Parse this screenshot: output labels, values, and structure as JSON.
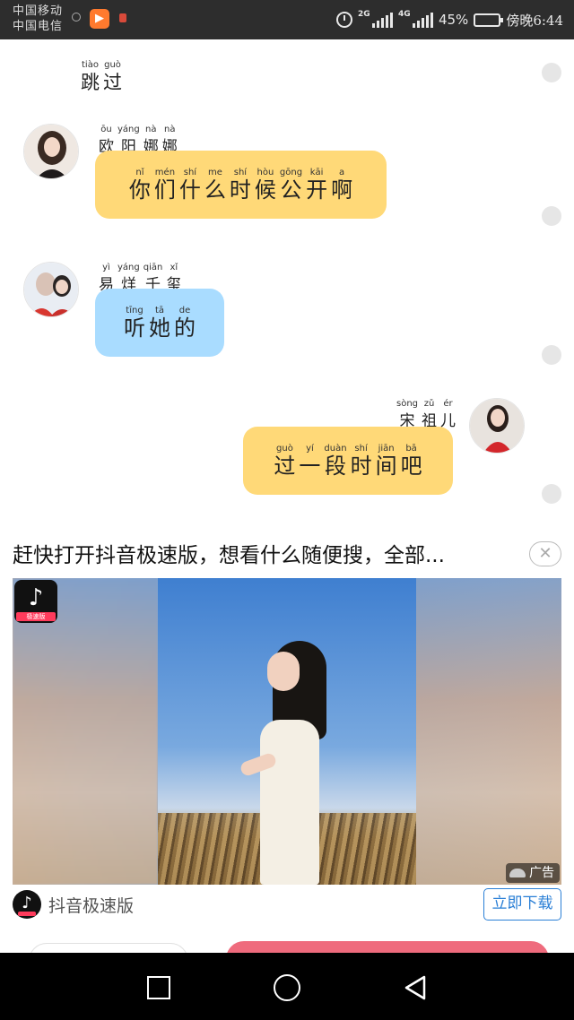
{
  "status_bar": {
    "carrier_1": "中国移动",
    "carrier_2": "中国电信",
    "network_1": "2G",
    "network_2": "4G",
    "battery": "45%",
    "time": "傍晚6:44"
  },
  "chat": {
    "skip": [
      {
        "py": "tiào",
        "hz": "跳"
      },
      {
        "py": "guò",
        "hz": "过"
      }
    ],
    "messages": [
      {
        "name": [
          {
            "py": "ōu",
            "hz": "欧"
          },
          {
            "py": "yáng",
            "hz": "阳"
          },
          {
            "py": "nà",
            "hz": "娜"
          },
          {
            "py": "nà",
            "hz": "娜"
          }
        ],
        "text": [
          {
            "py": "nǐ",
            "hz": "你"
          },
          {
            "py": "mén",
            "hz": "们"
          },
          {
            "py": "shí",
            "hz": "什"
          },
          {
            "py": "me",
            "hz": "么"
          },
          {
            "py": "shí",
            "hz": "时"
          },
          {
            "py": "hòu",
            "hz": "候"
          },
          {
            "py": "gōng",
            "hz": "公"
          },
          {
            "py": "kāi",
            "hz": "开"
          },
          {
            "py": "a",
            "hz": "啊"
          }
        ]
      },
      {
        "name": [
          {
            "py": "yì",
            "hz": "易"
          },
          {
            "py": "yáng",
            "hz": "烊"
          },
          {
            "py": "qiān",
            "hz": "千"
          },
          {
            "py": "xǐ",
            "hz": "玺"
          }
        ],
        "text": [
          {
            "py": "tīng",
            "hz": "听"
          },
          {
            "py": "tā",
            "hz": "她"
          },
          {
            "py": "de",
            "hz": "的"
          }
        ]
      },
      {
        "name": [
          {
            "py": "sòng",
            "hz": "宋"
          },
          {
            "py": "zǔ",
            "hz": "祖"
          },
          {
            "py": "ér",
            "hz": "儿"
          }
        ],
        "text": [
          {
            "py": "guò",
            "hz": "过"
          },
          {
            "py": "yí",
            "hz": "一"
          },
          {
            "py": "duàn",
            "hz": "段"
          },
          {
            "py": "shí",
            "hz": "时"
          },
          {
            "py": "jiān",
            "hz": "间"
          },
          {
            "py": "bā",
            "hz": "吧"
          }
        ]
      }
    ]
  },
  "ad": {
    "title": "赶快打开抖音极速版，想看什么随便搜，全部...",
    "close": "✕",
    "badge_sub": "极速版",
    "label": "广告",
    "app_name": "抖音极速版",
    "download": "立即下载"
  },
  "colors": {
    "bubble_yellow": "#ffd978",
    "bubble_blue": "#a9dcff",
    "download_blue": "#2a7fd6",
    "peek_pink": "#ef6b7d"
  }
}
